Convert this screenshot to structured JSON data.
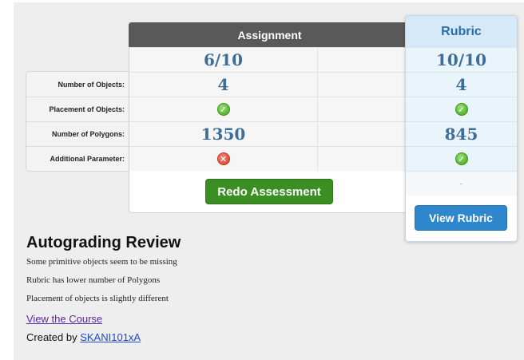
{
  "assignment": {
    "header": "Assignment",
    "score": "6/10",
    "num_objects": "4",
    "num_polygons": "1350",
    "redo_label": "Redo Assessment",
    "placement_status": "check",
    "additional_status": "cross"
  },
  "labels": [
    "Number of Objects:",
    "Placement of Objects:",
    "Number of Polygons:",
    "Additional Parameter:"
  ],
  "rubric": {
    "header": "Rubric",
    "score": "10/10",
    "num_objects": "4",
    "num_polygons": "845",
    "extra": "-",
    "view_label": "View Rubric",
    "placement_status": "check",
    "additional_status": "check"
  },
  "review": {
    "title": "Autograding Review",
    "lines": [
      "Some primitive objects seem to be missing",
      "Rubric has lower number of Polygons",
      "Placement of objects is slightly different"
    ],
    "course_link": "View the Course",
    "created_prefix": "Created by",
    "author": "SKANI101xA"
  },
  "colors": {
    "check": "#3ea21a",
    "cross": "#d23a24",
    "value_blue": "#3e6d98",
    "redo_green": "#3a8e22",
    "view_blue": "#2e86cd"
  }
}
